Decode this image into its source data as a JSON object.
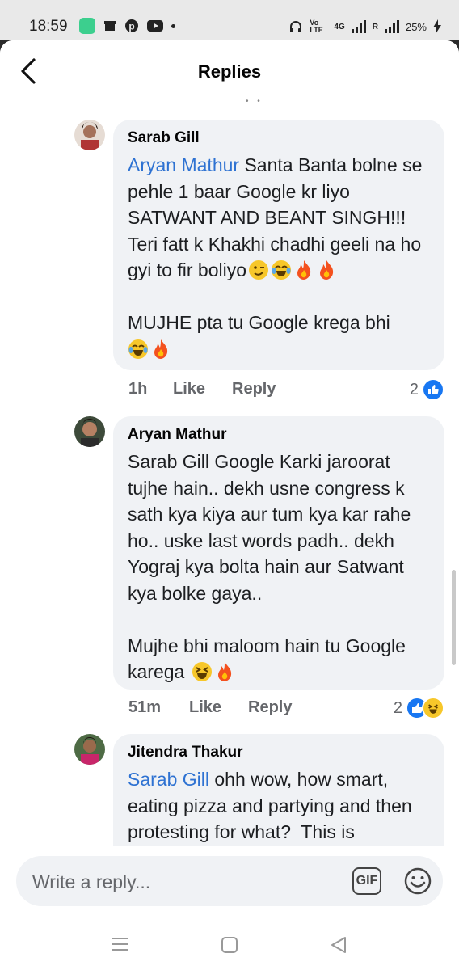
{
  "status_bar": {
    "time": "18:59",
    "network_label_1": "Vo LTE",
    "network_label_2": "4G",
    "network_label_3": "R",
    "battery": "25%"
  },
  "header": {
    "title": "Replies"
  },
  "comments": [
    {
      "author": "Sarab Gill",
      "mention": "Aryan Mathur",
      "text_1": " Santa Banta bolne se pehle 1 baar Google kr liyo SATWANT AND BEANT SINGH!!! Teri fatt k Khakhi chadhi geeli na ho gyi to fir boliyo",
      "text_2": "MUJHE pta tu Google krega bhi",
      "time": "1h",
      "like_label": "Like",
      "reply_label": "Reply",
      "reaction_count": "2"
    },
    {
      "author": "Aryan Mathur",
      "text_1": "Sarab Gill Google Karki jaroorat tujhe hain.. dekh usne congress k sath kya kiya aur tum kya kar rahe ho.. uske last words padh.. dekh Yograj kya bolta hain aur Satwant kya bolke gaya..",
      "text_2": "Mujhe bhi maloom hain tu Google karega",
      "time": "51m",
      "like_label": "Like",
      "reply_label": "Reply",
      "reaction_count": "2"
    },
    {
      "author": "Jitendra Thakur",
      "mention": "Sarab Gill",
      "text_1": " ohh wow, how smart, eating pizza and partying and then protesting for what?  This is"
    }
  ],
  "composer": {
    "placeholder": "Write a reply...",
    "gif_label": "GIF"
  },
  "colors": {
    "mention": "#2e72d2",
    "like_blue": "#1877f2",
    "bubble_bg": "#f0f2f5"
  }
}
